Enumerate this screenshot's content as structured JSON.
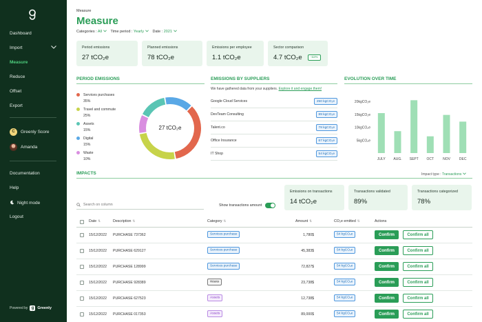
{
  "sidebar": {
    "items": [
      {
        "label": "Dashboard",
        "active": false
      },
      {
        "label": "Import",
        "active": false
      },
      {
        "label": "Measure",
        "active": true
      },
      {
        "label": "Reduce",
        "active": false
      },
      {
        "label": "Offset",
        "active": false
      },
      {
        "label": "Export",
        "active": false
      }
    ],
    "score_badge": "C",
    "score_label": "Greenly Score",
    "user_name": "Amanda",
    "bottom": [
      "Documentation",
      "Help",
      "Night mode",
      "Logout"
    ],
    "powered_by": "Powered by",
    "brand": "Greenly",
    "brand_glyph": "g"
  },
  "header": {
    "breadcrumb": "Measure",
    "title": "Measure",
    "filters": [
      {
        "label": "Categories :",
        "value": "All"
      },
      {
        "label": "Time period :",
        "value": "Yearly"
      },
      {
        "label": "Date :",
        "value": "2021"
      }
    ]
  },
  "kpis": [
    {
      "label": "Period emissions",
      "value": "27 tCO₂e"
    },
    {
      "label": "Planned emissions",
      "value": "78 tCO₂e"
    },
    {
      "label": "Emissions per employee",
      "value": "1.1 tCO₂e"
    },
    {
      "label": "Sector comparison",
      "value": "4.7 tCO₂e",
      "badge": "-11%"
    }
  ],
  "period_emissions": {
    "title": "PERIOD EMISSIONS",
    "center_label": "27 tCO₂e",
    "legend": [
      {
        "name": "Services purchases",
        "pct": "35%",
        "value": 35,
        "color": "#e2674d"
      },
      {
        "name": "Travel and commute",
        "pct": "25%",
        "value": 25,
        "color": "#c7d34a"
      },
      {
        "name": "Assets",
        "pct": "15%",
        "value": 15,
        "color": "#5ac5b4"
      },
      {
        "name": "Digital",
        "pct": "15%",
        "value": 15,
        "color": "#5aa8e6"
      },
      {
        "name": "Waste",
        "pct": "10%",
        "value": 10,
        "color": "#d98ee0"
      }
    ]
  },
  "suppliers": {
    "title": "EMISSIONS BY SUPPLIERS",
    "intro": "We have gathered data from your suppliers.",
    "intro_link": "Explore it and engage them!",
    "rows": [
      {
        "name": "Google Cloud Services",
        "value": "250 kgCO₂e"
      },
      {
        "name": "DevTeam Consulting",
        "value": "89 kgCO₂e"
      },
      {
        "name": "Talent.co",
        "value": "78 kgCO₂e"
      },
      {
        "name": "Office Insurance",
        "value": "67 kgCO₂e"
      },
      {
        "name": "IT Shop",
        "value": "54 kgCO₂e"
      }
    ]
  },
  "evolution": {
    "title": "EVOLUTION OVER TIME"
  },
  "chart_data": {
    "type": "bar",
    "categories": [
      "JULY",
      "AUG.",
      "SEPT",
      "OCT",
      "NOV",
      "DEC"
    ],
    "values": [
      15.5,
      8.5,
      20.5,
      6.5,
      14.8,
      12.2
    ],
    "yticks": [
      "5kgCO₂e",
      "10kgCO₂e",
      "15kgCO₂e",
      "20kgCO₂e"
    ],
    "ytick_values": [
      5,
      10,
      15,
      20
    ],
    "ylim": [
      0,
      23
    ],
    "color": "#9fdfb5"
  },
  "impacts": {
    "title": "IMPACTS",
    "impact_type_label": "Impact type :",
    "impact_type_value": "Transactions",
    "cards": [
      {
        "label": "Emissions on transactions",
        "value": "14 tCO₂e"
      },
      {
        "label": "Transactions validated",
        "value": "89%"
      },
      {
        "label": "Transactions categorized",
        "value": "78%"
      }
    ],
    "search_placeholder": "Search on column",
    "toggle_label": "Show transactions amount",
    "columns": [
      "Date",
      "Description",
      "Category",
      "Amount",
      "CO₂e emitted",
      "Actions"
    ],
    "confirm_label": "Confirm",
    "confirm_all_label": "Confirm all",
    "rows": [
      {
        "date": "15/12/2022",
        "desc": "PURCHASE 737362",
        "cat": "Services purchase",
        "cat_style": "blue",
        "amount": "1,780$",
        "co2": "54 kgCO₂e"
      },
      {
        "date": "15/12/2022",
        "desc": "PURCHASE 629127",
        "cat": "Services purchase",
        "cat_style": "blue",
        "amount": "45,383$",
        "co2": "54 kgCO₂e"
      },
      {
        "date": "15/12/2022",
        "desc": "PURCHASE 128999",
        "cat": "Services purchase",
        "cat_style": "blue",
        "amount": "72,827$",
        "co2": "54 kgCO₂e"
      },
      {
        "date": "15/12/2022",
        "desc": "PURCHASE 928389",
        "cat": "Waste",
        "cat_style": "gray",
        "amount": "23,738$",
        "co2": "54 kgCO₂e"
      },
      {
        "date": "15/12/2022",
        "desc": "PURCHASE 627523",
        "cat": "Assets",
        "cat_style": "purple",
        "amount": "12,738$",
        "co2": "54 kgCO₂e"
      },
      {
        "date": "15/12/2022",
        "desc": "PURCHASE 017353",
        "cat": "Assets",
        "cat_style": "purple",
        "amount": "89,000$",
        "co2": "54 kgCO₂e"
      }
    ]
  },
  "colors": {
    "brand": "#2a9d57",
    "sidebar": "#10301e",
    "card": "#e9f5ec"
  }
}
